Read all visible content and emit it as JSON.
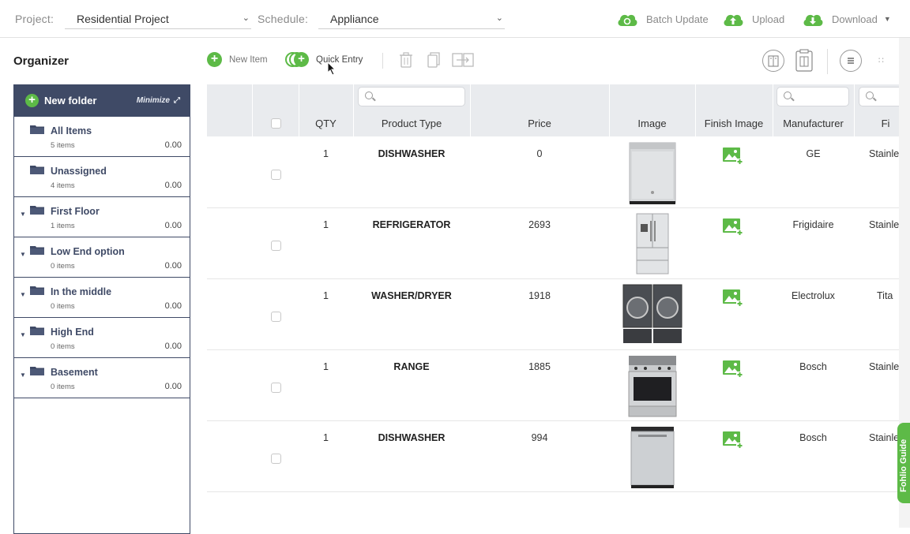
{
  "header": {
    "project_label": "Project:",
    "project_value": "Residential Project",
    "schedule_label": "Schedule:",
    "schedule_value": "Appliance",
    "batch_update": "Batch Update",
    "upload": "Upload",
    "download": "Download"
  },
  "organizer": {
    "title": "Organizer",
    "new_folder": "New folder",
    "minimize": "Minimize",
    "folders": [
      {
        "name": "All Items",
        "count": "5 items",
        "value": "0.00"
      },
      {
        "name": "Unassigned",
        "count": "4 items",
        "value": "0.00"
      },
      {
        "name": "First Floor",
        "count": "1 items",
        "value": "0.00"
      },
      {
        "name": "Low End option",
        "count": "0 items",
        "value": "0.00"
      },
      {
        "name": "In the middle",
        "count": "0 items",
        "value": "0.00"
      },
      {
        "name": "High End",
        "count": "0 items",
        "value": "0.00"
      },
      {
        "name": "Basement",
        "count": "0 items",
        "value": "0.00"
      }
    ]
  },
  "toolbar": {
    "new_item": "New Item",
    "quick_entry": "Quick Entry"
  },
  "table": {
    "columns": [
      "QTY",
      "Product Type",
      "Price",
      "Image",
      "Finish Image",
      "Manufacturer",
      "Fi"
    ],
    "rows": [
      {
        "qty": "1",
        "product_type": "DISHWASHER",
        "price": "0",
        "manufacturer": "GE",
        "finish": "Stainle"
      },
      {
        "qty": "1",
        "product_type": "REFRIGERATOR",
        "price": "2693",
        "manufacturer": "Frigidaire",
        "finish": "Stainle"
      },
      {
        "qty": "1",
        "product_type": "WASHER/DRYER",
        "price": "1918",
        "manufacturer": "Electrolux",
        "finish": "Tita"
      },
      {
        "qty": "1",
        "product_type": "RANGE",
        "price": "1885",
        "manufacturer": "Bosch",
        "finish": "Stainle"
      },
      {
        "qty": "1",
        "product_type": "DISHWASHER",
        "price": "994",
        "manufacturer": "Bosch",
        "finish": "Stainle"
      }
    ]
  },
  "guide": {
    "label": "Fohlio Guide"
  },
  "colors": {
    "accent_green": "#5dba47",
    "navy": "#3f4a66"
  }
}
